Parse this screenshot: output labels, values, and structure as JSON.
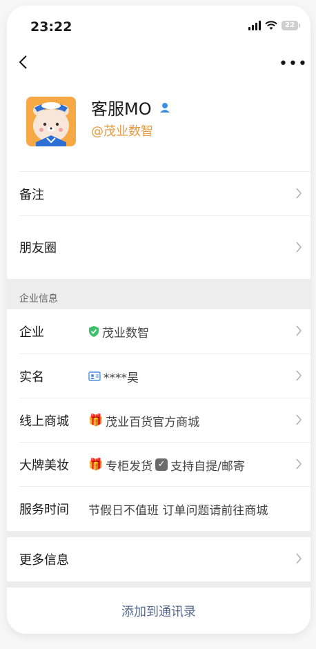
{
  "status": {
    "time": "23:22",
    "battery": "22"
  },
  "profile": {
    "name": "客服MO",
    "company_tag": "@茂业数智"
  },
  "rows": {
    "remark": "备注",
    "moments": "朋友圈"
  },
  "enterprise": {
    "section_title": "企业信息",
    "company_label": "企业",
    "company_value": "茂业数智",
    "realname_label": "实名",
    "realname_value": "****昊",
    "mall_label": "线上商城",
    "mall_value": "茂业百货官方商城",
    "brand_label": "大牌美妆",
    "brand_value_1": "专柜发货",
    "brand_value_2": "支持自提/邮寄",
    "hours_label": "服务时间",
    "hours_value": "节假日不值班 订单问题请前往商城"
  },
  "more_info": "更多信息",
  "add_contact": "添加到通讯录",
  "colors": {
    "accent": "#566a8f",
    "tag": "#e6993f",
    "verified": "#3ebf6b"
  }
}
